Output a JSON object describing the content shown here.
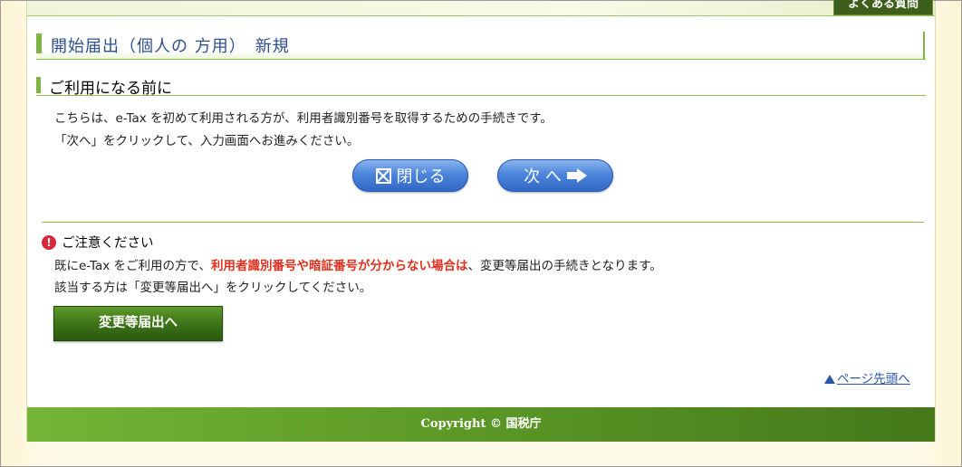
{
  "header": {
    "faq_label": "よくある質問"
  },
  "page_title": "開始届出（個人の 方用）　新規",
  "section": {
    "title": "ご利用になる前に",
    "line1": "こちらは、e-Tax を初めて利用される方が、利用者識別番号を取得するための手続きです。",
    "line2": "「次へ」をクリックして、入力画面へお進みください。"
  },
  "buttons": {
    "close_label": "閉じる",
    "next_label": "次 へ"
  },
  "notice": {
    "title": "ご注意ください",
    "line1_pre": "既にe-Tax をご利用の方で、",
    "line1_red": "利用者識別番号や暗証番号が分からない場合は",
    "line1_post": "、変更等届出の手続きとなります。",
    "line2": "該当する方は「変更等届出へ」をクリックしてください。",
    "icon_text": "!",
    "change_button_label": "変更等届出へ"
  },
  "links": {
    "page_top": "ページ先頭へ"
  },
  "footer": {
    "copyright": "Copyright © 国税庁"
  }
}
